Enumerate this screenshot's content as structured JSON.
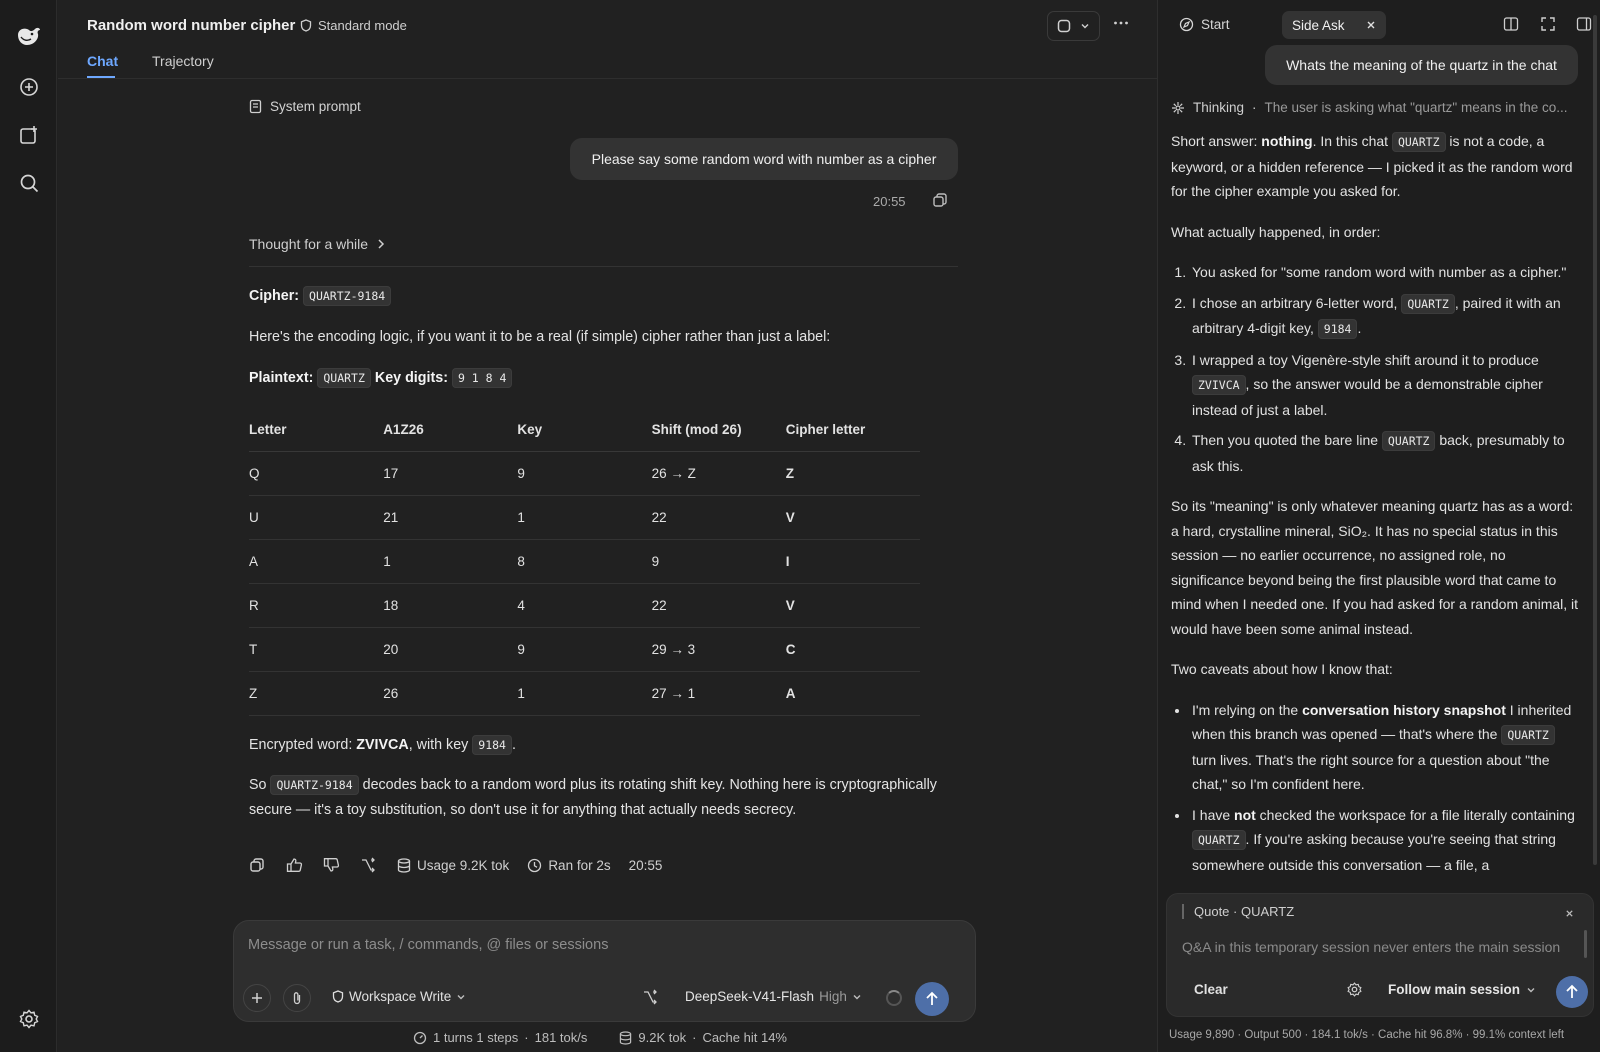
{
  "rail": {
    "icons": [
      "whale-logo-icon",
      "new-chat-icon",
      "new-task-icon",
      "search-icon",
      "settings-icon"
    ]
  },
  "header": {
    "title": "Random word number cipher",
    "mode": "Standard mode",
    "tabs": [
      {
        "label": "Chat",
        "active": true
      },
      {
        "label": "Trajectory",
        "active": false
      }
    ]
  },
  "chat": {
    "system_prompt": "System prompt",
    "user_message": "Please say some random word with number as a cipher",
    "user_time": "20:55",
    "thought": "Thought for a while",
    "cipher_label": "Cipher:",
    "cipher_code": "QUARTZ-9184",
    "intro": "Here's the encoding logic, if you want it to be a real (if simple) cipher rather than just a label:",
    "plaintext_label": "Plaintext:",
    "plaintext_code": "QUARTZ",
    "key_label": "Key digits:",
    "key_code": "9 1 8 4",
    "table": {
      "headers": [
        "Letter",
        "A1Z26",
        "Key",
        "Shift (mod 26)",
        "Cipher letter"
      ],
      "rows": [
        [
          "Q",
          "17",
          "9",
          "26 → Z",
          "Z"
        ],
        [
          "U",
          "21",
          "1",
          "22",
          "V"
        ],
        [
          "A",
          "1",
          "8",
          "9",
          "I"
        ],
        [
          "R",
          "18",
          "4",
          "22",
          "V"
        ],
        [
          "T",
          "20",
          "9",
          "29 → 3",
          "C"
        ],
        [
          "Z",
          "26",
          "1",
          "27 → 1",
          "A"
        ]
      ]
    },
    "encrypted_prefix": "Encrypted word: ",
    "encrypted_word": "ZVIVCA",
    "encrypted_mid": ", with key ",
    "encrypted_key": "9184",
    "encrypted_suffix": ".",
    "closing_prefix": "So ",
    "closing_code": "QUARTZ-9184",
    "closing_line1": " decodes back to a random word plus its rotating shift key. Nothing here is cryptographically",
    "closing_line2": "secure — it's a toy substitution, so don't use it for anything that actually needs secrecy.",
    "actions": {
      "usage": "Usage 9.2K tok",
      "ran": "Ran for 2s",
      "time": "20:55"
    }
  },
  "composer": {
    "placeholder": "Message or run a task, / commands, @ files or sessions",
    "workspace": "Workspace Write",
    "model": "DeepSeek-V41-Flash",
    "level": "High"
  },
  "status": {
    "turns": "1 turns 1 steps",
    "speed": "181 tok/s",
    "tokens": "9.2K tok",
    "cache": "Cache hit 14%"
  },
  "side": {
    "start": "Start",
    "tab": "Side Ask",
    "user_message": "Whats the meaning of the quartz in the chat",
    "thinking_label": "Thinking",
    "thinking_summary": "The user is asking what \"quartz\" means in the co...",
    "p1_a": "Short answer: ",
    "p1_b": "nothing",
    "p1_c": ". In this chat ",
    "p1_code": "QUARTZ",
    "p1_d": " is not a code, a keyword, or a hidden reference — I picked it as the random word for the cipher example you asked for.",
    "p2": "What actually happened, in order:",
    "ol1": "You asked for \"some random word with number as a cipher.\"",
    "ol2_a": "I chose an arbitrary 6-letter word, ",
    "ol2_code1": "QUARTZ",
    "ol2_b": ", paired it with an arbitrary 4-digit key, ",
    "ol2_code2": "9184",
    "ol2_c": ".",
    "ol3_a": "I wrapped a toy Vigenère-style shift around it to produce ",
    "ol3_code": "ZVIVCA",
    "ol3_b": ", so the answer would be a demonstrable cipher instead of just a label.",
    "ol4_a": "Then you quoted the bare line ",
    "ol4_code": "QUARTZ",
    "ol4_b": " back, presumably to ask this.",
    "p3": "So its \"meaning\" is only whatever meaning quartz has as a word: a hard, crystalline mineral, SiO₂. It has no special status in this session — no earlier occurrence, no assigned role, no significance beyond being the first plausible word that came to mind when I needed one. If you had asked for a random animal, it would have been some animal instead.",
    "p4": "Two caveats about how I know that:",
    "ul1_a": "I'm relying on the ",
    "ul1_b": "conversation history snapshot",
    "ul1_c": " I inherited when this branch was opened — that's where the ",
    "ul1_code": "QUARTZ",
    "ul1_d": " turn lives. That's the right source for a question about \"the chat,\" so I'm confident here.",
    "ul2_a": "I have ",
    "ul2_b": "not",
    "ul2_c": " checked the workspace for a file literally containing ",
    "ul2_code": "QUARTZ",
    "ul2_d": ". If you're asking because you're seeing that string somewhere outside this conversation — a file, a",
    "quote": "Quote · QUARTZ",
    "input_placeholder": "Q&A in this temporary session never enters the main session context",
    "clear": "Clear",
    "follow": "Follow main session",
    "usage": "Usage 9,890 · Output 500 · 184.1 tok/s · Cache hit 96.8% · 99.1% context left"
  }
}
